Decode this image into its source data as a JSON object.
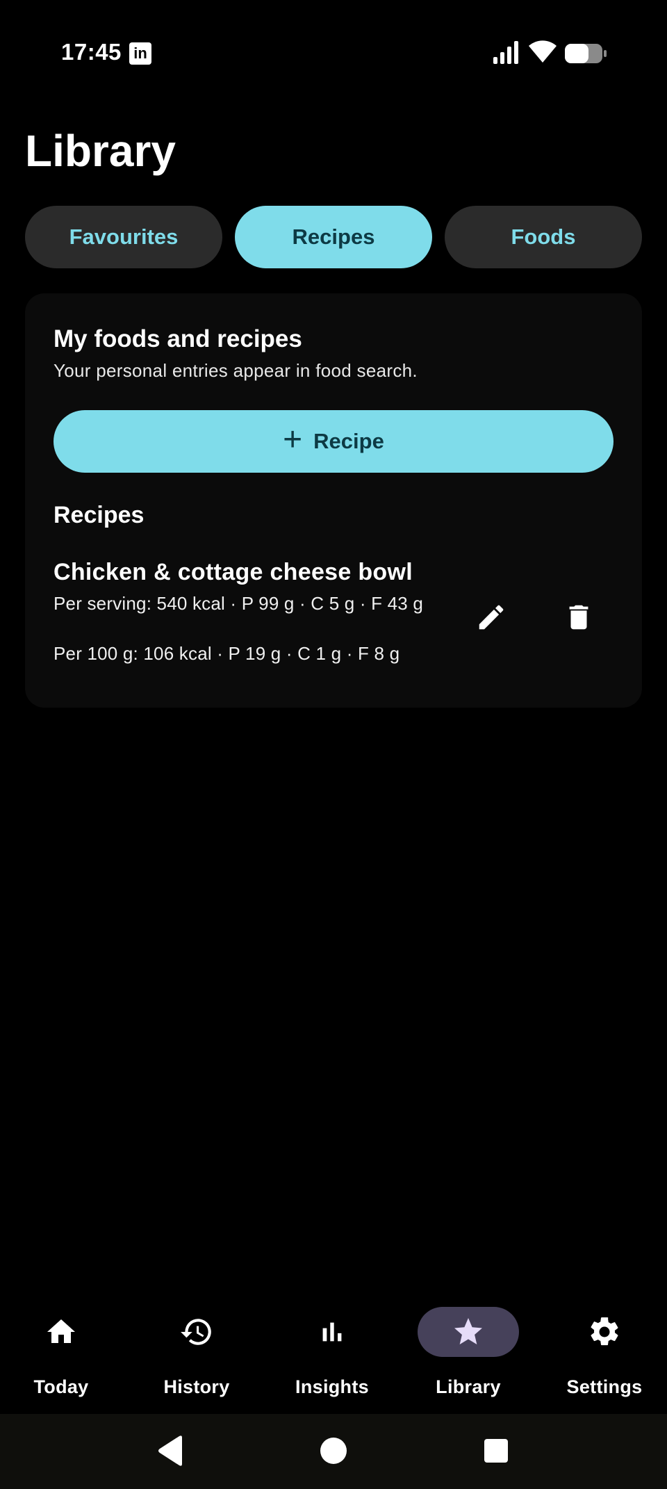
{
  "status_bar": {
    "time": "17:45",
    "notification_icon": "linkedin-icon",
    "icons": [
      "signal-icon",
      "wifi-icon",
      "battery-icon"
    ]
  },
  "page": {
    "title": "Library"
  },
  "tabs": [
    {
      "label": "Favourites",
      "active": false
    },
    {
      "label": "Recipes",
      "active": true
    },
    {
      "label": "Foods",
      "active": false
    }
  ],
  "card": {
    "title": "My foods and recipes",
    "subtitle": "Your personal entries appear in food search.",
    "add_button": {
      "icon": "plus-icon",
      "label": "Recipe"
    },
    "section_title": "Recipes",
    "recipes": [
      {
        "name": "Chicken & cottage cheese bowl",
        "per_serving": "Per serving: 540 kcal · P 99 g · C 5 g · F 43 g",
        "per_100g": "Per 100 g: 106 kcal · P 19 g · C 1 g · F 8 g",
        "actions": [
          "edit-icon",
          "delete-icon"
        ]
      }
    ]
  },
  "bottom_nav": [
    {
      "label": "Today",
      "icon": "home-icon",
      "active": false
    },
    {
      "label": "History",
      "icon": "history-icon",
      "active": false
    },
    {
      "label": "Insights",
      "icon": "bar-chart-icon",
      "active": false
    },
    {
      "label": "Library",
      "icon": "star-icon",
      "active": true
    },
    {
      "label": "Settings",
      "icon": "gear-icon",
      "active": false
    }
  ],
  "colors": {
    "accent": "#7fdcea",
    "accent_text": "#0d3a44",
    "tab_inactive": "#2b2b2b",
    "nav_active_pill": "#46415a",
    "nav_active_icon": "#e6dcf8"
  }
}
